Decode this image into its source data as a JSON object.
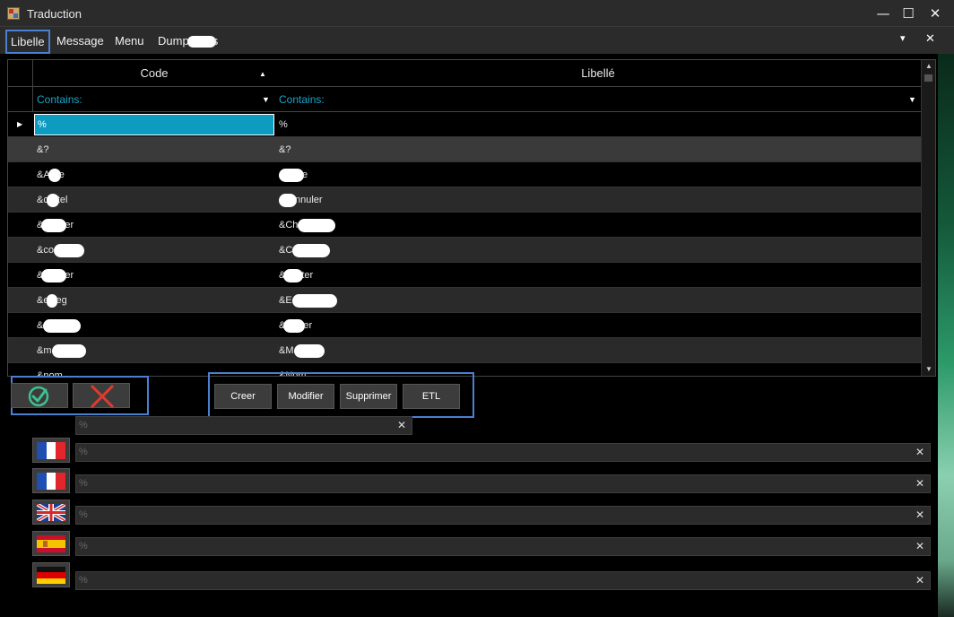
{
  "window": {
    "title": "Traduction",
    "minimize": "—",
    "maximize": "☐",
    "close": "✕"
  },
  "menubar": {
    "items": [
      "Libelle",
      "Message",
      "Menu",
      "Dump"
    ],
    "dump_suffix": "s",
    "pin": "▾",
    "close": "✕"
  },
  "grid": {
    "columns": [
      "Code",
      "Libellé"
    ],
    "filter_label": "Contains:",
    "rows": [
      {
        "code": "%",
        "libelle": "%"
      },
      {
        "code": "&?",
        "libelle": "&?"
      },
      {
        "code": "&A",
        "code_tail": "e",
        "libelle": "",
        "libelle_tail": "e"
      },
      {
        "code": "&c",
        "code_tail": "tel",
        "libelle": "",
        "libelle_tail": "nnuler"
      },
      {
        "code": "&",
        "code_tail": "er",
        "libelle": "&Ch",
        "libelle_tail": ""
      },
      {
        "code": "&co",
        "code_tail": "",
        "libelle": "&C",
        "libelle_tail": ""
      },
      {
        "code": "&",
        "code_tail": "er",
        "libelle": "&",
        "libelle_tail": "ter"
      },
      {
        "code": "&e",
        "code_tail": "eg",
        "libelle": "&E",
        "libelle_tail": ""
      },
      {
        "code": "&",
        "code_tail": "",
        "libelle": "&",
        "libelle_tail": "er"
      },
      {
        "code": "&m",
        "code_tail": "",
        "libelle": "&M",
        "libelle_tail": ""
      },
      {
        "code": "&nom",
        "code_tail": "",
        "libelle": "&Nom",
        "libelle_tail": ""
      }
    ]
  },
  "actions": {
    "create": "Creer",
    "modify": "Modifier",
    "delete": "Supprimer",
    "etl": "ETL"
  },
  "fields": {
    "code": "%",
    "translations": [
      {
        "flag": "france",
        "value": "%"
      },
      {
        "flag": "france",
        "value": "%"
      },
      {
        "flag": "united-kingdom",
        "value": "%"
      },
      {
        "flag": "spain",
        "value": "%"
      },
      {
        "flag": "germany",
        "value": "%"
      }
    ],
    "clear": "✕"
  },
  "colors": {
    "accent": "#0e9bc0",
    "filter_text": "#1aa3c9",
    "highlight_border": "#4a7fd1",
    "confirm": "#3fbf8f",
    "cancel": "#e23b2e"
  }
}
